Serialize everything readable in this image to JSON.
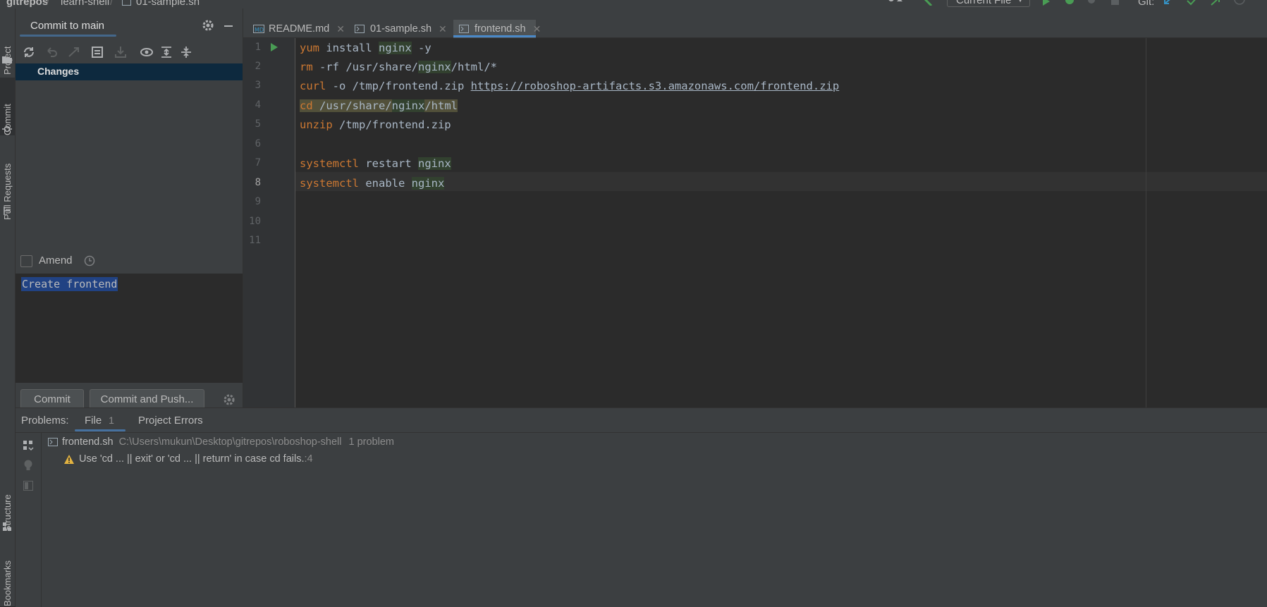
{
  "navbar": {
    "crumbs": [
      "gitrepos",
      "learn-shell",
      "01-sample.sh"
    ],
    "run_config": "Current File",
    "git_label": "Git:"
  },
  "left_strip": {
    "tabs": [
      "Project",
      "Commit",
      "Pull Requests",
      "Structure",
      "Bookmarks"
    ]
  },
  "commit_panel": {
    "title": "Commit to main",
    "changes_label": "Changes",
    "amend_label": "Amend",
    "message": "Create frontend",
    "commit_button": "Commit",
    "commit_push_button": "Commit and Push..."
  },
  "editor_tabs": [
    {
      "label": "README.md",
      "icon": "markdown-file-icon"
    },
    {
      "label": "01-sample.sh",
      "icon": "shell-file-icon"
    },
    {
      "label": "frontend.sh",
      "icon": "shell-file-icon",
      "active": true
    }
  ],
  "editor": {
    "line_numbers": [
      "1",
      "2",
      "3",
      "4",
      "5",
      "6",
      "7",
      "8",
      "9",
      "10",
      "11"
    ],
    "current_line": "8",
    "lines": {
      "l1_kw": "yum",
      "l1_a": " install ",
      "l1_b": "nginx",
      "l1_c": " -y",
      "l2_kw": "rm",
      "l2_a": " -rf /usr/share/",
      "l2_b": "nginx",
      "l2_c": "/html/*",
      "l3_kw": "curl",
      "l3_a": " -o /tmp/frontend.zip ",
      "l3_url": "https://roboshop-artifacts.s3.amazonaws.com/frontend.zip",
      "l4_kw": "cd",
      "l4_a": " /usr/share/",
      "l4_b": "nginx",
      "l4_c": "/html",
      "l5_kw": "unzip",
      "l5_a": " /tmp/frontend.zip",
      "l7_kw": "systemctl",
      "l7_a": " restart ",
      "l7_b": "nginx",
      "l8_kw": "systemctl",
      "l8_a": " enable ",
      "l8_b": "nginx"
    }
  },
  "problems": {
    "tabs": {
      "problems_label": "Problems:",
      "file_label": "File",
      "file_count": "1",
      "project_errors_label": "Project Errors"
    },
    "file": {
      "name": "frontend.sh",
      "path": "C:\\Users\\mukun\\Desktop\\gitrepos\\roboshop-shell",
      "count": "1 problem"
    },
    "warning": {
      "text": "Use 'cd ... || exit' or 'cd ... || return' in case cd fails.",
      "line": ":4"
    }
  },
  "colors": {
    "accent": "#4a88c7",
    "keyword": "#cc7832",
    "run_green": "#499c54",
    "warning": "#e3b341"
  }
}
